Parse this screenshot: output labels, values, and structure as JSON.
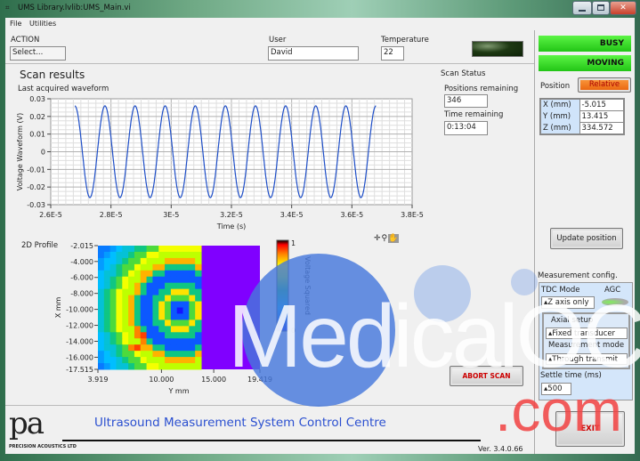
{
  "window": {
    "title": "UMS Library.lvlib:UMS_Main.vi",
    "controls": [
      "minimize",
      "maximize",
      "close"
    ]
  },
  "menu": [
    "File",
    "Utilities"
  ],
  "action": {
    "label": "ACTION",
    "value": "Select..."
  },
  "user": {
    "label": "User",
    "value": "David"
  },
  "temperature": {
    "label": "Temperature",
    "value": "22"
  },
  "scan_results": {
    "title": "Scan results",
    "waveform_label": "Last acquired waveform",
    "profile_label": "2D Profile"
  },
  "scan_status": {
    "title": "Scan Status",
    "positions_label": "Positions remaining",
    "positions_value": "346",
    "time_label": "Time remaining",
    "time_value": "0:13:04"
  },
  "status": {
    "busy": "BUSY",
    "moving": "MOVING",
    "indicator_color": "#2fd21e"
  },
  "position": {
    "label": "Position",
    "mode": "Relative",
    "mode_color": "#f07010",
    "rows": [
      {
        "axis": "X (mm)",
        "value": "-5.015"
      },
      {
        "axis": "Y (mm)",
        "value": "13.415"
      },
      {
        "axis": "Z (mm)",
        "value": "334.572"
      }
    ],
    "update_button": "Update position"
  },
  "measurement": {
    "title": "Measurement config.",
    "tdc_label": "TDC Mode",
    "tdc_value": "Z axis only",
    "agc_label": "AGC",
    "axial_label": "Axial setup",
    "axial_value": "Fixed transducer",
    "mode_label": "Measurement mode",
    "mode_value": "Through transmit",
    "settle_label": "Settle time (ms)",
    "settle_value": "500"
  },
  "buttons": {
    "abort": "ABORT SCAN",
    "exit": "EXIT"
  },
  "footer": {
    "title": "Ultrasound Measurement System Control Centre",
    "version": "Ver. 3.4.0.66",
    "logo_text": "PRECISION ACOUSTICS LTD",
    "logo_mark": "pa"
  },
  "watermark": {
    "text": "MedicalOC",
    "suffix": ".com"
  },
  "chart_data": [
    {
      "type": "line",
      "xlabel": "Time (s)",
      "ylabel": "Voltage Waveform (V)",
      "xlim": [
        2.6e-05,
        3.8e-05
      ],
      "ylim": [
        -0.03,
        0.03
      ],
      "grid": true,
      "xticks": [
        "2.6E-5",
        "2.8E-5",
        "3E-5",
        "3.2E-5",
        "3.4E-5",
        "3.6E-5",
        "3.8E-5"
      ],
      "yticks": [
        "0.03",
        "0.02",
        "0.01",
        "0",
        "-0.01",
        "-0.02",
        "-0.03"
      ],
      "series": [
        {
          "waveform": "cosine",
          "t_start": 2.68e-05,
          "t_end": 3.68e-05,
          "amplitude": 0.026,
          "frequency_hz": 1000000,
          "color": "#1f4fc8"
        }
      ]
    },
    {
      "type": "heatmap",
      "xlabel": "Y mm",
      "ylabel": "X mm",
      "colorbar_label": "Voltage Squared",
      "xlim": [
        3.919,
        19.419
      ],
      "ylim": [
        -2.015,
        -17.515
      ],
      "xticks": [
        "3.919",
        "10.000",
        "15.000",
        "19.419"
      ],
      "yticks": [
        "-2.015",
        "-4.000",
        "-6.000",
        "-8.000",
        "-10.000",
        "-12.000",
        "-14.000",
        "-16.000",
        "-17.515"
      ],
      "colorbar_ticks": [
        "1",
        "0"
      ],
      "zlim": [
        0,
        1
      ],
      "scanned_ylim": [
        3.919,
        13.8
      ],
      "values": [
        [
          0.15,
          0.15,
          0.2,
          0.25,
          0.3,
          0.3,
          0.4,
          0.4,
          0.5,
          0.5,
          0.7,
          0.7,
          0.7,
          0.7,
          0.7,
          0.7,
          0.7
        ],
        [
          0.15,
          0.2,
          0.25,
          0.3,
          0.3,
          0.4,
          0.5,
          0.5,
          0.7,
          0.7,
          0.6,
          0.6,
          0.6,
          0.6,
          0.6,
          0.6,
          0.6
        ],
        [
          0.2,
          0.25,
          0.25,
          0.3,
          0.4,
          0.5,
          0.5,
          0.7,
          0.6,
          0.6,
          0.6,
          0.8,
          0.8,
          0.8,
          0.8,
          0.8,
          0.6
        ],
        [
          0.2,
          0.25,
          0.3,
          0.4,
          0.5,
          0.5,
          0.7,
          0.6,
          0.6,
          0.8,
          0.8,
          0.4,
          0.4,
          0.4,
          0.4,
          0.4,
          0.8
        ],
        [
          0.25,
          0.3,
          0.3,
          0.4,
          0.5,
          0.7,
          0.6,
          0.8,
          0.8,
          0.4,
          0.4,
          0.1,
          0.1,
          0.1,
          0.1,
          0.1,
          0.4
        ],
        [
          0.25,
          0.3,
          0.4,
          0.5,
          0.7,
          0.6,
          0.6,
          0.8,
          0.4,
          0.1,
          0.1,
          0.1,
          0.1,
          0.1,
          0.1,
          0.1,
          0.1
        ],
        [
          0.25,
          0.3,
          0.4,
          0.5,
          0.7,
          0.6,
          0.8,
          0.4,
          0.1,
          0.1,
          0.1,
          0.4,
          0.4,
          0.4,
          0.4,
          0.4,
          0.1
        ],
        [
          0.3,
          0.4,
          0.5,
          0.7,
          0.6,
          0.6,
          0.8,
          0.4,
          0.1,
          0.1,
          0.4,
          0.4,
          0.75,
          0.75,
          0.75,
          0.4,
          0.4
        ],
        [
          0.3,
          0.4,
          0.5,
          0.7,
          0.6,
          0.8,
          0.4,
          0.1,
          0.1,
          0.4,
          0.4,
          0.75,
          0.5,
          0.5,
          0.5,
          0.75,
          0.4
        ],
        [
          0.3,
          0.4,
          0.5,
          0.7,
          0.6,
          0.8,
          0.4,
          0.1,
          0.1,
          0.4,
          0.75,
          0.5,
          0.1,
          0.1,
          0.1,
          0.5,
          0.75
        ],
        [
          0.3,
          0.4,
          0.5,
          0.7,
          0.6,
          0.8,
          0.4,
          0.1,
          0.1,
          0.4,
          0.75,
          0.5,
          0.1,
          0.0,
          0.1,
          0.5,
          0.75
        ],
        [
          0.3,
          0.4,
          0.5,
          0.7,
          0.6,
          0.8,
          0.4,
          0.1,
          0.1,
          0.4,
          0.75,
          0.5,
          0.1,
          0.1,
          0.1,
          0.5,
          0.75
        ],
        [
          0.3,
          0.4,
          0.5,
          0.7,
          0.6,
          0.8,
          0.4,
          0.1,
          0.1,
          0.4,
          0.4,
          0.75,
          0.5,
          0.5,
          0.5,
          0.75,
          0.4
        ],
        [
          0.3,
          0.4,
          0.5,
          0.7,
          0.6,
          0.6,
          0.85,
          0.4,
          0.1,
          0.1,
          0.4,
          0.4,
          0.75,
          0.75,
          0.75,
          0.4,
          0.4
        ],
        [
          0.25,
          0.3,
          0.4,
          0.5,
          0.7,
          0.6,
          0.85,
          0.9,
          0.1,
          0.1,
          0.1,
          0.4,
          0.4,
          0.4,
          0.4,
          0.4,
          0.1
        ],
        [
          0.25,
          0.3,
          0.4,
          0.5,
          0.7,
          0.6,
          0.6,
          0.85,
          0.4,
          0.1,
          0.1,
          0.1,
          0.1,
          0.1,
          0.1,
          0.1,
          0.1
        ],
        [
          0.25,
          0.3,
          0.3,
          0.4,
          0.5,
          0.85,
          0.9,
          0.8,
          0.8,
          0.4,
          0.4,
          0.1,
          0.1,
          0.1,
          0.1,
          0.1,
          0.4
        ],
        [
          0.2,
          0.25,
          0.3,
          0.4,
          0.5,
          0.5,
          0.7,
          0.6,
          0.6,
          0.8,
          0.8,
          0.4,
          0.4,
          0.4,
          0.4,
          0.4,
          0.8
        ],
        [
          0.2,
          0.25,
          0.25,
          0.3,
          0.4,
          0.5,
          0.5,
          0.7,
          0.6,
          0.6,
          0.6,
          0.8,
          0.8,
          0.8,
          0.8,
          0.8,
          0.6
        ],
        [
          0.15,
          0.2,
          0.25,
          0.3,
          0.3,
          0.4,
          0.5,
          0.5,
          0.7,
          0.7,
          0.6,
          0.6,
          0.6,
          0.6,
          0.6,
          0.6,
          0.6
        ]
      ]
    }
  ]
}
